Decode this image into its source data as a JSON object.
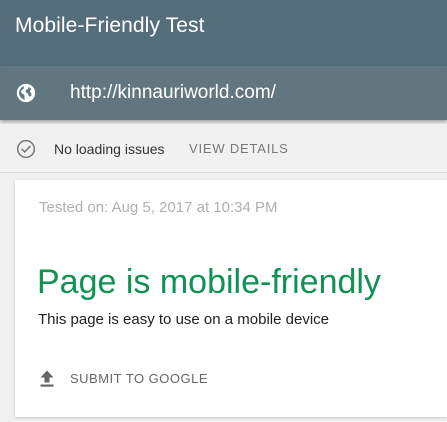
{
  "header": {
    "title": "Mobile-Friendly Test",
    "url": "http://kinnauriworld.com/"
  },
  "status": {
    "text": "No loading issues",
    "details_label": "VIEW DETAILS"
  },
  "result": {
    "tested_on": "Tested on: Aug 5, 2017 at 10:34 PM",
    "headline": "Page is mobile-friendly",
    "description": "This page is easy to use on a mobile device",
    "submit_label": "SUBMIT TO GOOGLE"
  },
  "colors": {
    "header_bg": "#546e7a",
    "url_bar_bg": "#62767f",
    "success_green": "#109255"
  },
  "icons": {
    "url": "globe-icon",
    "status": "check-circle-icon",
    "submit": "upload-icon"
  }
}
